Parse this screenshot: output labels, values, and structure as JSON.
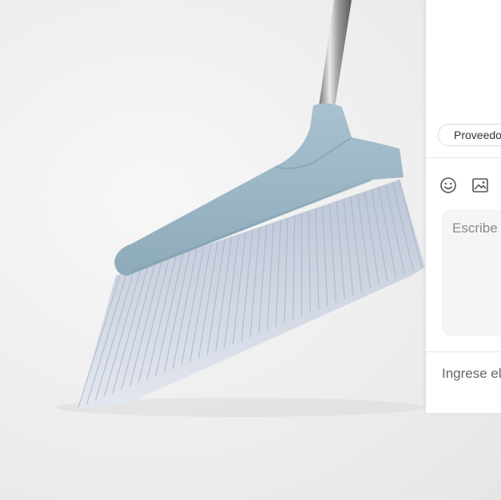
{
  "product_image": {
    "subject": "broom",
    "colors": {
      "head": "#9fb9c7",
      "head_shadow": "#86a3b3",
      "bristles": "#d6dbe6",
      "handle": "#b9b9b9"
    }
  },
  "chat_panel": {
    "supplier_chip": "Proveedo",
    "icons": [
      "smile-icon",
      "image-icon"
    ],
    "message_placeholder": "Escribe",
    "email_placeholder": "Ingrese el"
  }
}
